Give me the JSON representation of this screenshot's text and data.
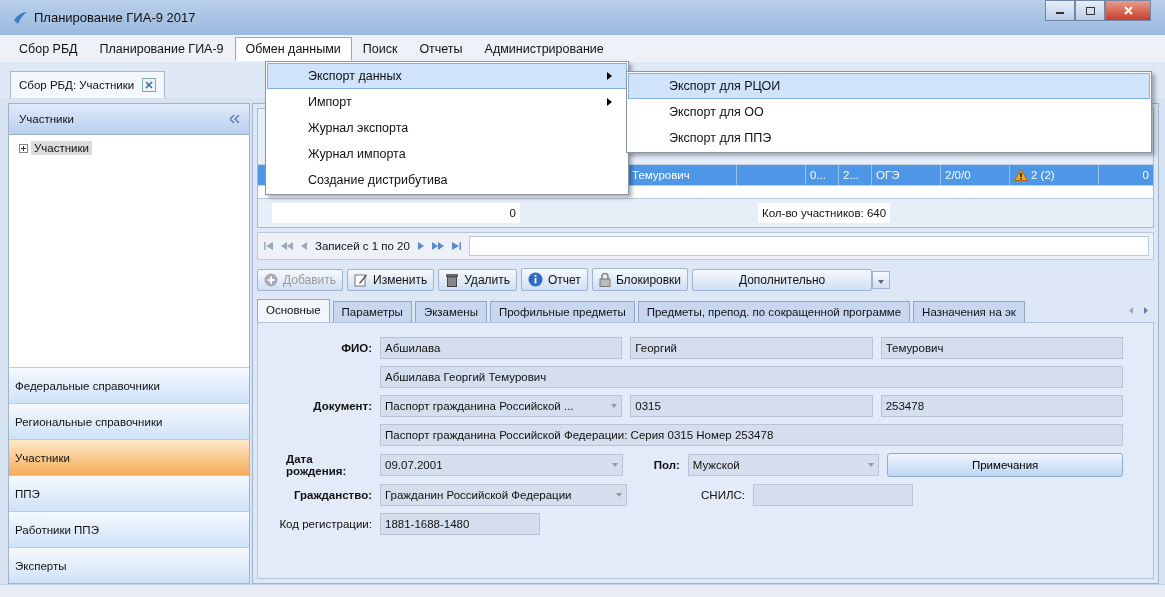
{
  "window": {
    "title": "Планирование ГИА-9 2017"
  },
  "menu": [
    {
      "label": "Сбор РБД",
      "selected": false
    },
    {
      "label": "Планирование ГИА-9",
      "selected": false
    },
    {
      "label": "Обмен данными",
      "selected": true
    },
    {
      "label": "Поиск",
      "selected": false
    },
    {
      "label": "Отчеты",
      "selected": false
    },
    {
      "label": "Администрирование",
      "selected": false
    }
  ],
  "dropdown": [
    {
      "label": "Экспорт данных",
      "submenu": true,
      "selected": true
    },
    {
      "label": "Импорт",
      "submenu": true,
      "selected": false
    },
    {
      "label": "Журнал экспорта",
      "submenu": false,
      "selected": false
    },
    {
      "label": "Журнал импорта",
      "submenu": false,
      "selected": false
    },
    {
      "label": "Создание дистрибутива",
      "submenu": false,
      "selected": false
    }
  ],
  "submenu": [
    {
      "label": "Экспорт для РЦОИ",
      "selected": true
    },
    {
      "label": "Экспорт для ОО",
      "selected": false
    },
    {
      "label": "Экспорт для ППЭ",
      "selected": false
    }
  ],
  "doc_tab": {
    "label": "Сбор РБД: Участники"
  },
  "left_panel": {
    "title": "Участники",
    "tree": [
      {
        "label": "Участники",
        "expanded": false,
        "selected": true
      }
    ],
    "nav": [
      {
        "label": "Федеральные справочники",
        "selected": false
      },
      {
        "label": "Региональные справочники",
        "selected": false
      },
      {
        "label": "Участники",
        "selected": true
      },
      {
        "label": "ППЭ",
        "selected": false
      },
      {
        "label": "Работники ППЭ",
        "selected": false
      },
      {
        "label": "Эксперты",
        "selected": false
      }
    ]
  },
  "grid": {
    "rows": [
      {
        "selected": true,
        "cells": [
          {
            "kind": "text",
            "text": "Темурович"
          },
          {
            "kind": "text",
            "text": ""
          },
          {
            "kind": "text",
            "text": "0..."
          },
          {
            "kind": "text",
            "text": "2..."
          },
          {
            "kind": "text",
            "text": "ОГЭ"
          },
          {
            "kind": "text",
            "text": "2/0/0"
          },
          {
            "kind": "warning",
            "text": "2 (2)"
          },
          {
            "kind": "number",
            "text": "0"
          }
        ]
      }
    ],
    "footer": {
      "count": "0",
      "total": "Кол-во участников: 640"
    },
    "pager": {
      "text": "Записей с 1 по 20"
    }
  },
  "toolbar": [
    {
      "label": "Добавить",
      "kind": "add",
      "disabled": true
    },
    {
      "label": "Изменить",
      "kind": "edit",
      "disabled": false
    },
    {
      "label": "Удалить",
      "kind": "delete",
      "disabled": false
    },
    {
      "label": "Отчет",
      "kind": "report",
      "disabled": false
    },
    {
      "label": "Блокировки",
      "kind": "lock",
      "disabled": false
    },
    {
      "label": "Дополнительно",
      "kind": "dropdown"
    }
  ],
  "tabs": [
    {
      "label": "Основные",
      "selected": true
    },
    {
      "label": "Параметры",
      "selected": false
    },
    {
      "label": "Экзамены",
      "selected": false
    },
    {
      "label": "Профильные предметы",
      "selected": false
    },
    {
      "label": "Предметы, препод. по сокращенной программе",
      "selected": false
    },
    {
      "label": "Назначения на эк",
      "selected": false
    }
  ],
  "form": {
    "fio_label": "ФИО:",
    "fio": [
      "Абшилава",
      "Георгий",
      "Темурович"
    ],
    "fio_full": "Абшилава Георгий Темурович",
    "doc_label": "Документ:",
    "doc_type": "Паспорт гражданина Российской ...",
    "doc_series": "0315",
    "doc_number": "253478",
    "doc_full": "Паспорт гражданина Российской Федерации: Серия 0315 Номер 253478",
    "birth_label": "Дата рождения:",
    "birth": "09.07.2001",
    "sex_label": "Пол:",
    "sex": "Мужской",
    "notes_button": "Примечания",
    "citizenship_label": "Гражданство:",
    "citizenship": "Гражданин Российской Федерации",
    "snils_label": "СНИЛС:",
    "reg_label": "Код регистрации:",
    "reg": "1881-1688-1480"
  }
}
